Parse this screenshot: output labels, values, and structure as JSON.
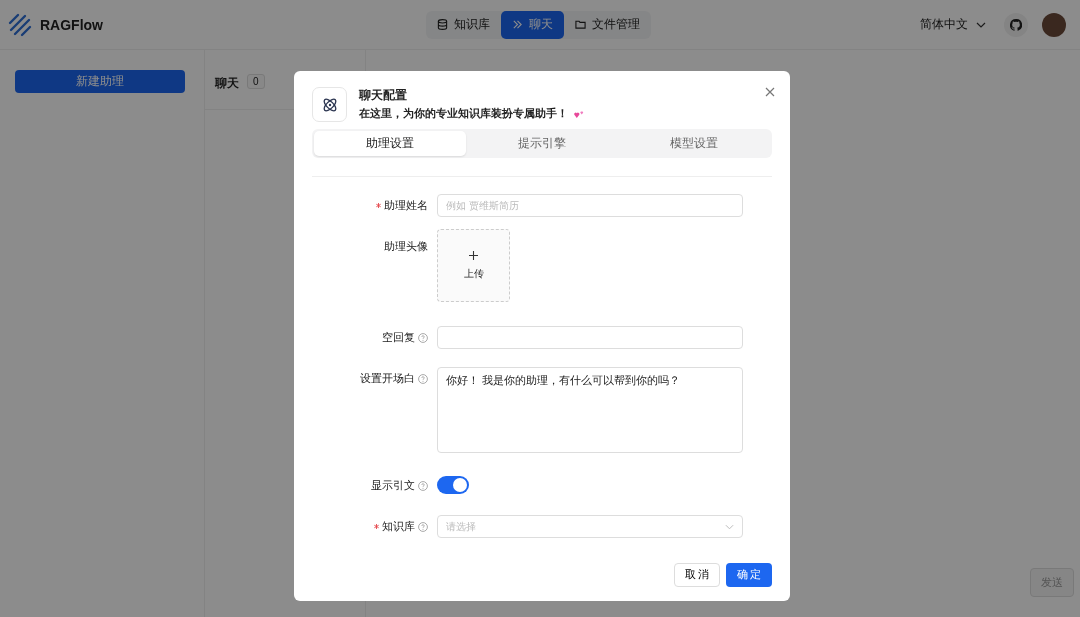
{
  "header": {
    "brand": "RAGFlow",
    "nav": [
      {
        "label": "知识库",
        "kind": "database",
        "selected": false
      },
      {
        "label": "聊天",
        "kind": "chat",
        "selected": true
      },
      {
        "label": "文件管理",
        "kind": "files",
        "selected": false
      }
    ],
    "language": "简体中文"
  },
  "sidebar": {
    "new_button": "新建助理"
  },
  "chat_list": {
    "title": "聊天",
    "count": "0"
  },
  "send_button": "发送",
  "dialog": {
    "title": "聊天配置",
    "subtitle": "在这里，为你的专业知识库装扮专属助手！",
    "tabs": [
      {
        "label": "助理设置",
        "selected": true
      },
      {
        "label": "提示引擎",
        "selected": false
      },
      {
        "label": "模型设置",
        "selected": false
      }
    ],
    "fields": [
      {
        "kind": "text",
        "label": "助理姓名",
        "required": true,
        "help": false,
        "placeholder": "例如 贾维斯简历"
      },
      {
        "kind": "upload",
        "label": "助理头像",
        "required": false,
        "help": false,
        "button": "上传"
      },
      {
        "kind": "text",
        "label": "空回复",
        "required": false,
        "help": true
      },
      {
        "kind": "textarea",
        "label": "设置开场白",
        "required": false,
        "help": true,
        "value": "你好！ 我是你的助理，有什么可以帮到你的吗？"
      },
      {
        "kind": "switch",
        "label": "显示引文",
        "required": false,
        "help": true,
        "on": true
      },
      {
        "kind": "select",
        "label": "知识库",
        "required": true,
        "help": true,
        "placeholder": "请选择"
      }
    ],
    "cancel": "取 消",
    "ok": "确 定"
  }
}
